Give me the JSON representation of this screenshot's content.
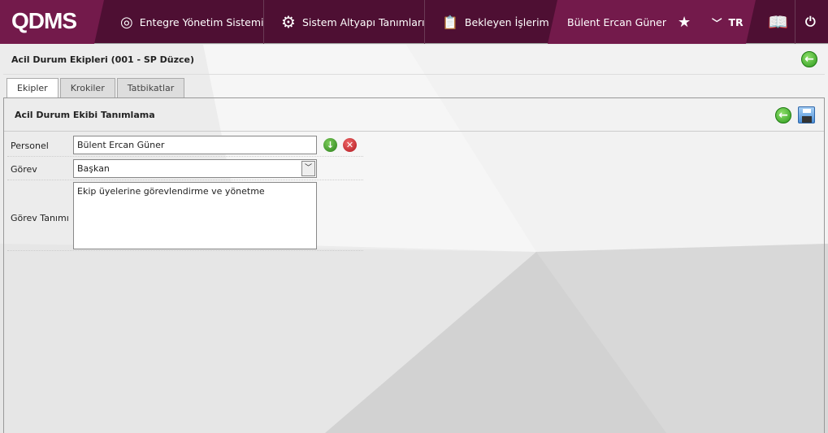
{
  "header": {
    "logo": "QDMS",
    "nav": [
      {
        "label": "Entegre Yönetim Sistemi",
        "icon": "qdms-q-icon"
      },
      {
        "label": "Sistem Altyapı Tanımları",
        "icon": "gear-icon"
      },
      {
        "label": "Bekleyen İşlerim",
        "icon": "clipboard-check-icon"
      }
    ],
    "user": "Bülent Ercan Güner",
    "language": "TR"
  },
  "page": {
    "title": "Acil Durum Ekipleri (001 - SP Düzce)"
  },
  "tabs": [
    {
      "label": "Ekipler",
      "active": true
    },
    {
      "label": "Krokiler"
    },
    {
      "label": "Tatbikatlar"
    }
  ],
  "panel": {
    "title": "Acil Durum Ekibi Tanımlama"
  },
  "form": {
    "personel": {
      "label": "Personel",
      "value": "Bülent Ercan Güner"
    },
    "gorev": {
      "label": "Görev",
      "value": "Başkan"
    },
    "gorev_tanimi": {
      "label": "Görev Tanımı",
      "value": "Ekip üyelerine görevlendirme ve yönetme"
    }
  },
  "colors": {
    "brand": "#731a4b",
    "brand_dark": "#4e0f33",
    "ok": "#2d9a1e",
    "danger": "#c8202a"
  }
}
